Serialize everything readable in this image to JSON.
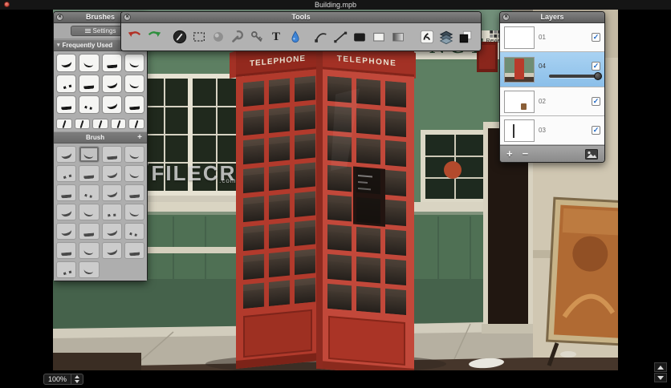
{
  "window": {
    "title": "Building.mpb"
  },
  "panels": {
    "brushes": {
      "title": "Brushes",
      "settings_label": "Settings",
      "sections": {
        "frequently_used": "Frequently Used",
        "brush": "Brush",
        "add_button": "+"
      }
    },
    "tools": {
      "title": "Tools",
      "text_tool_label": "T",
      "review_label": "Review"
    },
    "layers": {
      "title": "Layers",
      "rows": [
        {
          "label": "01",
          "checked": true,
          "selected": false
        },
        {
          "label": "04",
          "checked": true,
          "selected": true,
          "opacity_slider": true
        },
        {
          "label": "02",
          "checked": true,
          "selected": false
        },
        {
          "label": "03",
          "checked": true,
          "selected": false
        }
      ],
      "add_label": "+",
      "remove_label": "−"
    }
  },
  "canvas": {
    "telephone_sign_left": "TELEPHONE",
    "telephone_sign_right": "TELEPHONE",
    "building_sign_letters": "NCT"
  },
  "status": {
    "zoom_value": "100%"
  },
  "watermark": {
    "logo": "F",
    "text": "FILECR",
    "suffix": ".com"
  },
  "colors": {
    "selection_blue": "#9ec9ef",
    "check_blue": "#1f68c5",
    "phone_red": "#b83b2b",
    "facade_green": "#5d7f62"
  }
}
